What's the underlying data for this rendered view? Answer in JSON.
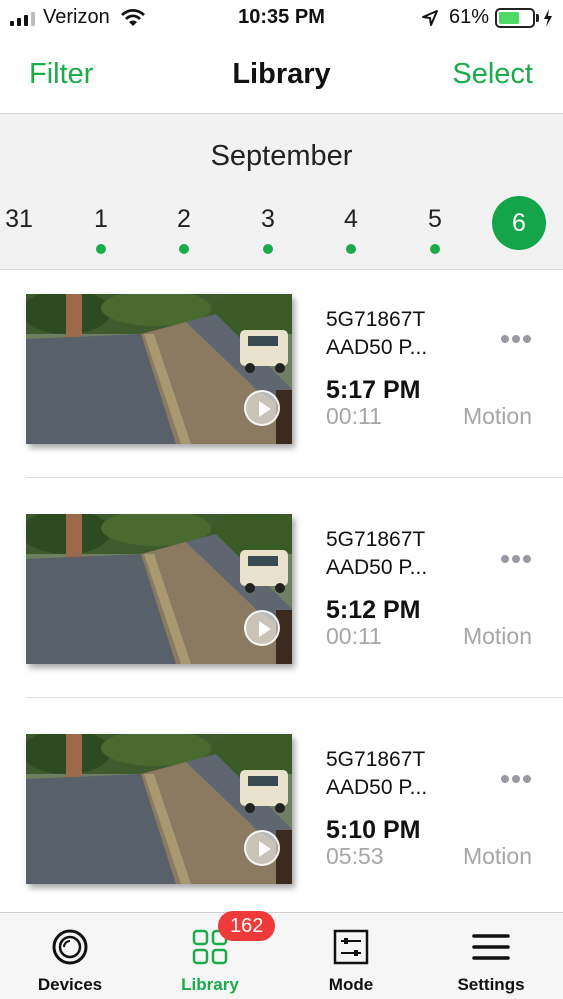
{
  "status_bar": {
    "carrier": "Verizon",
    "time": "10:35 PM",
    "battery_percent": "61%",
    "battery_level": 0.61
  },
  "nav": {
    "filter_label": "Filter",
    "title": "Library",
    "select_label": "Select"
  },
  "date_strip": {
    "month": "September",
    "days": [
      {
        "label": "31",
        "has_events": false,
        "selected": false
      },
      {
        "label": "1",
        "has_events": true,
        "selected": false
      },
      {
        "label": "2",
        "has_events": true,
        "selected": false
      },
      {
        "label": "3",
        "has_events": true,
        "selected": false
      },
      {
        "label": "4",
        "has_events": true,
        "selected": false
      },
      {
        "label": "5",
        "has_events": true,
        "selected": false
      },
      {
        "label": "6",
        "has_events": false,
        "selected": true
      }
    ]
  },
  "clips": [
    {
      "name_line1": "5G71867T",
      "name_line2": "AAD50 P...",
      "time": "5:17 PM",
      "duration": "00:11",
      "type": "Motion"
    },
    {
      "name_line1": "5G71867T",
      "name_line2": "AAD50 P...",
      "time": "5:12 PM",
      "duration": "00:11",
      "type": "Motion"
    },
    {
      "name_line1": "5G71867T",
      "name_line2": "AAD50 P...",
      "time": "5:10 PM",
      "duration": "05:53",
      "type": "Motion"
    }
  ],
  "tabs": [
    {
      "label": "Devices",
      "icon": "camera-lens-icon",
      "active": false
    },
    {
      "label": "Library",
      "icon": "grid-icon",
      "active": true,
      "badge": "162"
    },
    {
      "label": "Mode",
      "icon": "sliders-icon",
      "active": false
    },
    {
      "label": "Settings",
      "icon": "hamburger-icon",
      "active": false
    }
  ],
  "colors": {
    "accent": "#1aab4a",
    "badge": "#f03a3a",
    "muted_text": "#a6a6a6"
  }
}
